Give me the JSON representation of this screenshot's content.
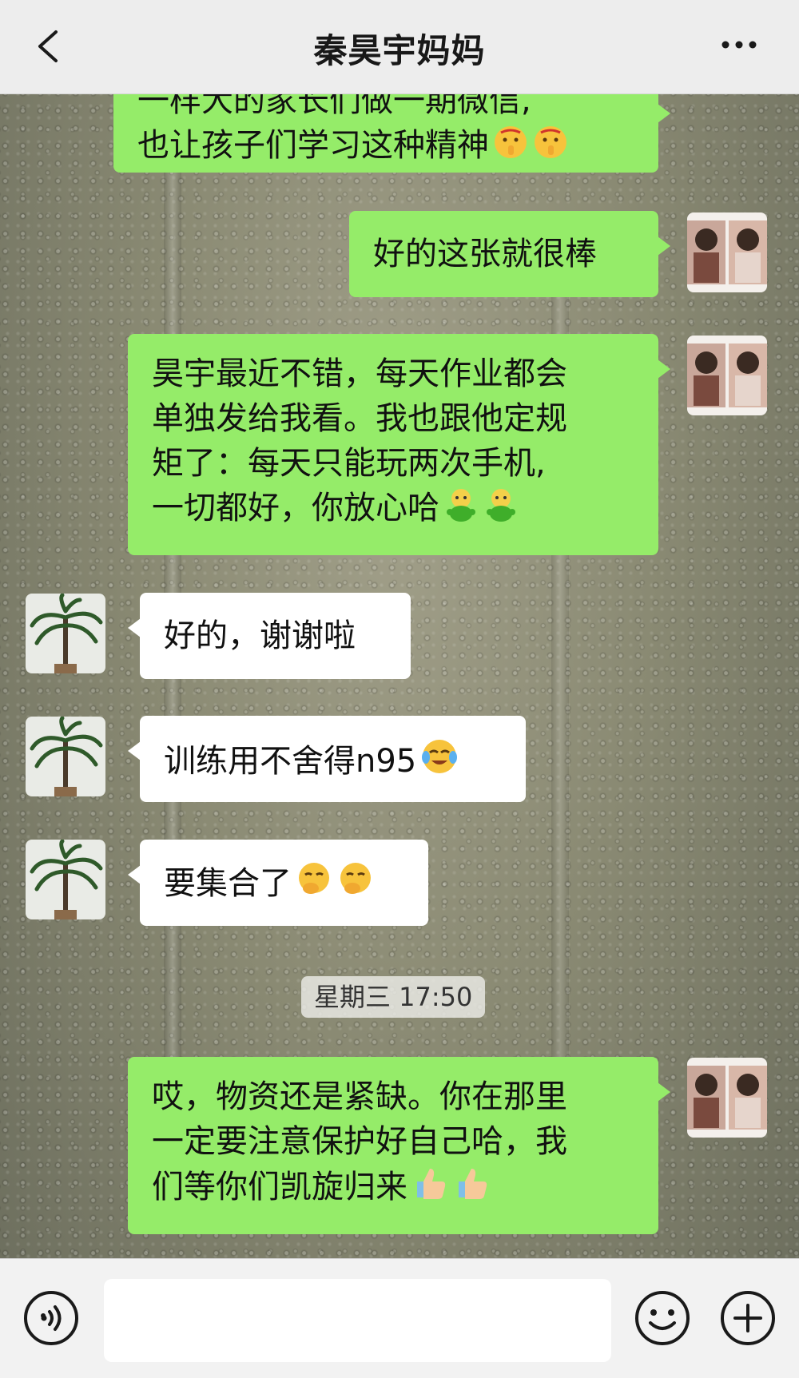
{
  "header": {
    "title": "秦昊宇妈妈"
  },
  "messages": [
    {
      "id": "m1",
      "direction": "sent",
      "lines": [
        "一样大的家长们做一期微信,",
        "也让孩子们学习这种精神"
      ],
      "emoji": [
        "shushing-face-emoji",
        "shushing-face-emoji"
      ]
    },
    {
      "id": "m2",
      "direction": "sent",
      "lines": [
        "好的这张就很棒"
      ]
    },
    {
      "id": "m3",
      "direction": "sent",
      "lines": [
        "昊宇最近不错，每天作业都会",
        "单独发给我看。我也跟他定规",
        "矩了：每天只能玩两次手机,",
        "一切都好，你放心哈"
      ],
      "emoji": [
        "green-doll-emoji",
        "green-doll-emoji"
      ]
    },
    {
      "id": "m4",
      "direction": "received",
      "lines": [
        "好的，谢谢啦"
      ]
    },
    {
      "id": "m5",
      "direction": "received",
      "lines": [
        "训练用不舍得n95"
      ],
      "emoji": [
        "crying-face-emoji"
      ]
    },
    {
      "id": "m6",
      "direction": "received",
      "lines": [
        "要集合了"
      ],
      "emoji": [
        "hand-over-mouth-emoji",
        "hand-over-mouth-emoji"
      ]
    },
    {
      "id": "m7",
      "direction": "sent",
      "lines": [
        "哎，物资还是紧缺。你在那里",
        "一定要注意保护好自己哈，我",
        "们等你们凯旋归来"
      ],
      "emoji": [
        "thumbs-up-emoji",
        "thumbs-up-emoji"
      ]
    }
  ],
  "timestamp": "星期三 17:50",
  "input_bar": {
    "message_value": "",
    "icons": [
      "voice-icon",
      "emoji-icon",
      "plus-icon"
    ]
  },
  "colors": {
    "sent_bubble": "#95ec69",
    "received_bubble": "#ffffff",
    "header_bg": "#ededed"
  }
}
